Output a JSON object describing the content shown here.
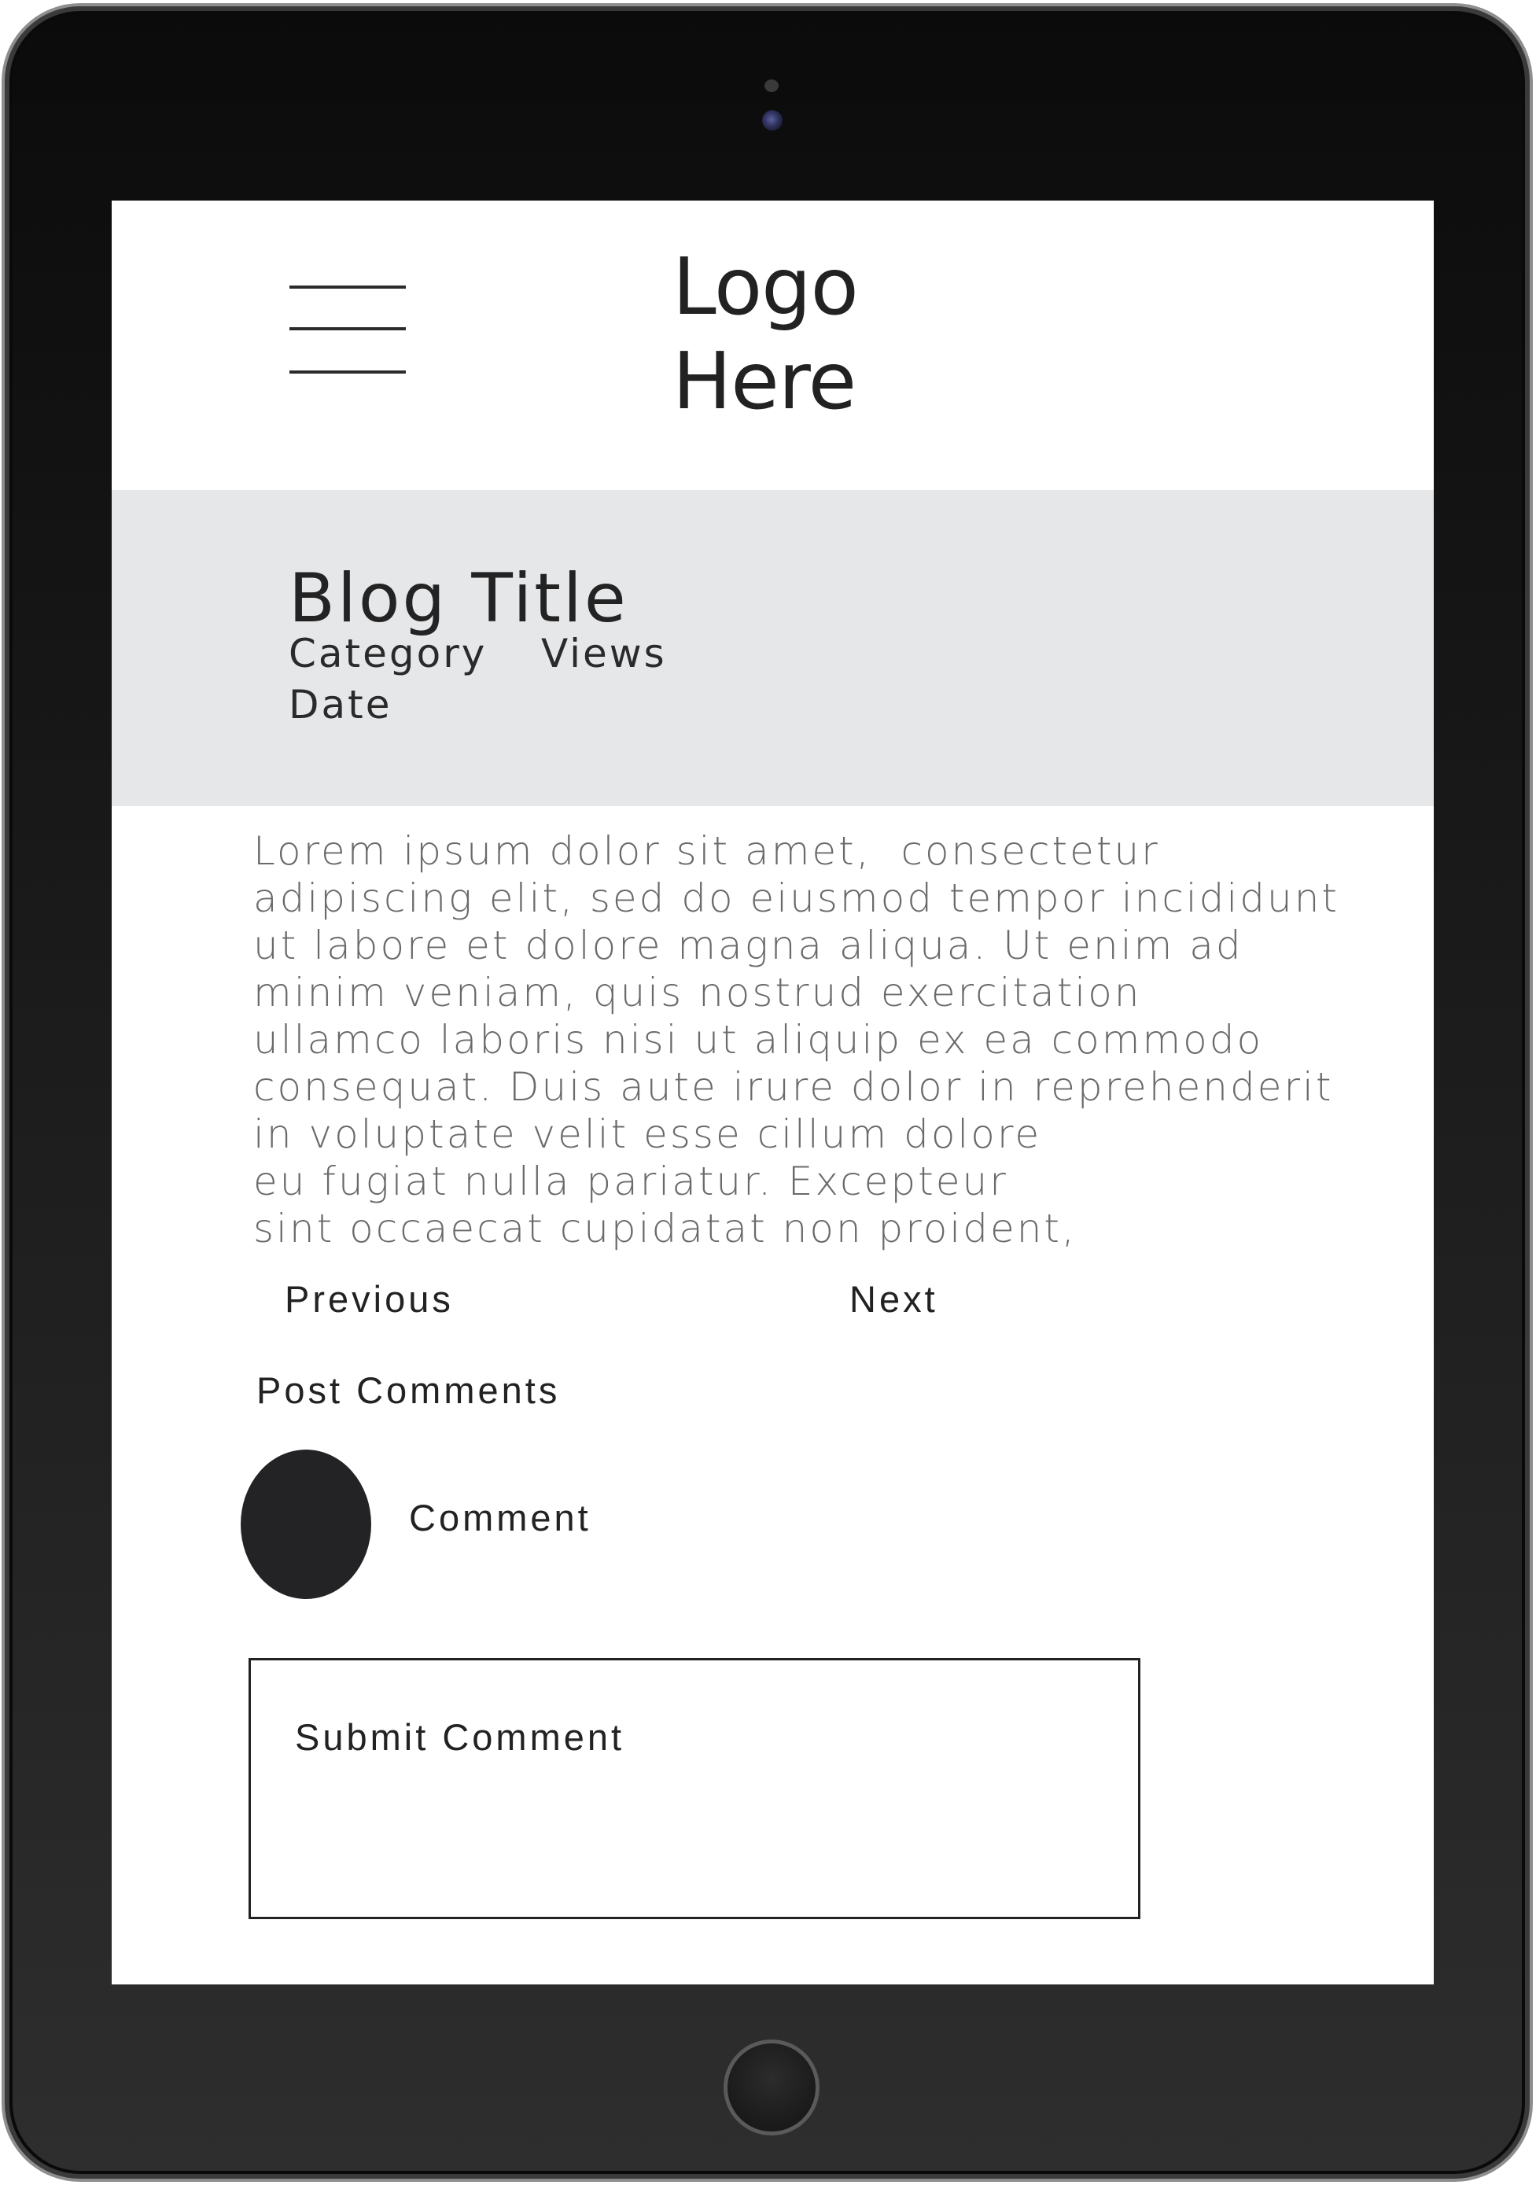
{
  "header": {
    "logo_line1": "Logo",
    "logo_line2": "Here",
    "menu_icon": "hamburger-menu-icon"
  },
  "post": {
    "title": "Blog Title",
    "category": "Category",
    "views": "Views",
    "date": "Date",
    "body": "Lorem ipsum dolor sit amet,  consectetur\nadipiscing elit, sed do eiusmod tempor incididunt\nut labore et dolore magna aliqua. Ut enim ad\nminim veniam, quis nostrud exercitation\nullamco laboris nisi ut aliquip ex ea commodo\nconsequat. Duis aute irure dolor in reprehenderit\nin voluptate velit esse cillum dolore\neu fugiat nulla pariatur. Excepteur\nsint occaecat cupidatat non proident,"
  },
  "pagination": {
    "previous": "Previous",
    "next": "Next"
  },
  "comments": {
    "heading": "Post Comments",
    "comment_label": "Comment",
    "submit_placeholder": "Submit Comment"
  },
  "colors": {
    "hero_background": "#e6e7e9",
    "text_dark": "#222222",
    "text_body": "#6a6a6a",
    "avatar": "#232224",
    "device_bezel": "#1b1b1b"
  }
}
